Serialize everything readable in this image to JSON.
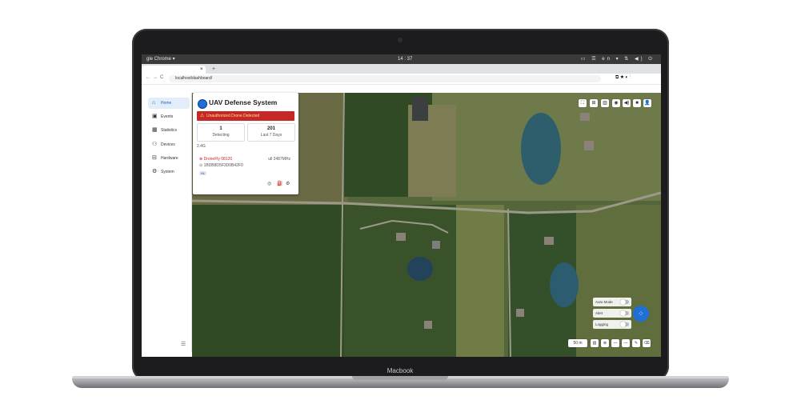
{
  "laptop": {
    "brand": "Macbook"
  },
  "os_bar": {
    "app": "gle Chrome ▾",
    "clock": "14 : 37",
    "tray": "▭ ☰ en ▾ ⇅ ◀) ⏻"
  },
  "browser": {
    "tab_close": "×",
    "new_tab": "+",
    "url": "localhost/dashboard/",
    "back": "←",
    "forward": "→",
    "reload": "C",
    "extensions": "⧉ ★ ◐ ⋮"
  },
  "sidebar": {
    "items": [
      {
        "label": "Home",
        "icon": "home-icon",
        "glyph": "⌂"
      },
      {
        "label": "Events",
        "icon": "events-icon",
        "glyph": "▣"
      },
      {
        "label": "Statistics",
        "icon": "statistics-icon",
        "glyph": "▦"
      },
      {
        "label": "Devices",
        "icon": "devices-icon",
        "glyph": "⚇"
      },
      {
        "label": "Hardware",
        "icon": "hardware-icon",
        "glyph": "⊟"
      },
      {
        "label": "System",
        "icon": "gear-icon",
        "glyph": "⚙"
      }
    ],
    "collapse": "☰"
  },
  "panel": {
    "title": "UAV Defense System",
    "alert": "Unauthorized Drone Detected",
    "alert_icon": "⚠",
    "detecting_count": "1",
    "detecting_label": "Detecting",
    "last7_count": "201",
    "last7_label": "Last 7 Days",
    "section": "2.4G",
    "drone_name": "⊗ DroneFly 08120",
    "drone_signal": "ull 2487MHz",
    "drone_id": "⊙ 1BDB8D5F3D0B42F0",
    "drone_tag": "HL",
    "actions": [
      "◎",
      "⛽",
      "⚙"
    ]
  },
  "map_toolbar": [
    "⛶",
    "⊞",
    "▥",
    "◉",
    "◀)",
    "■",
    "👤"
  ],
  "toggles": [
    "Auto Mode",
    "Alert",
    "Logging"
  ],
  "fab": "⁘",
  "bottom_tools": {
    "scale": "50 m",
    "items": [
      "▥",
      "⊕",
      "—",
      "—",
      "✎",
      "⌫"
    ]
  },
  "colors": {
    "accent": "#1e6fd6",
    "alert": "#c62828",
    "alert_text": "#ffe082"
  }
}
